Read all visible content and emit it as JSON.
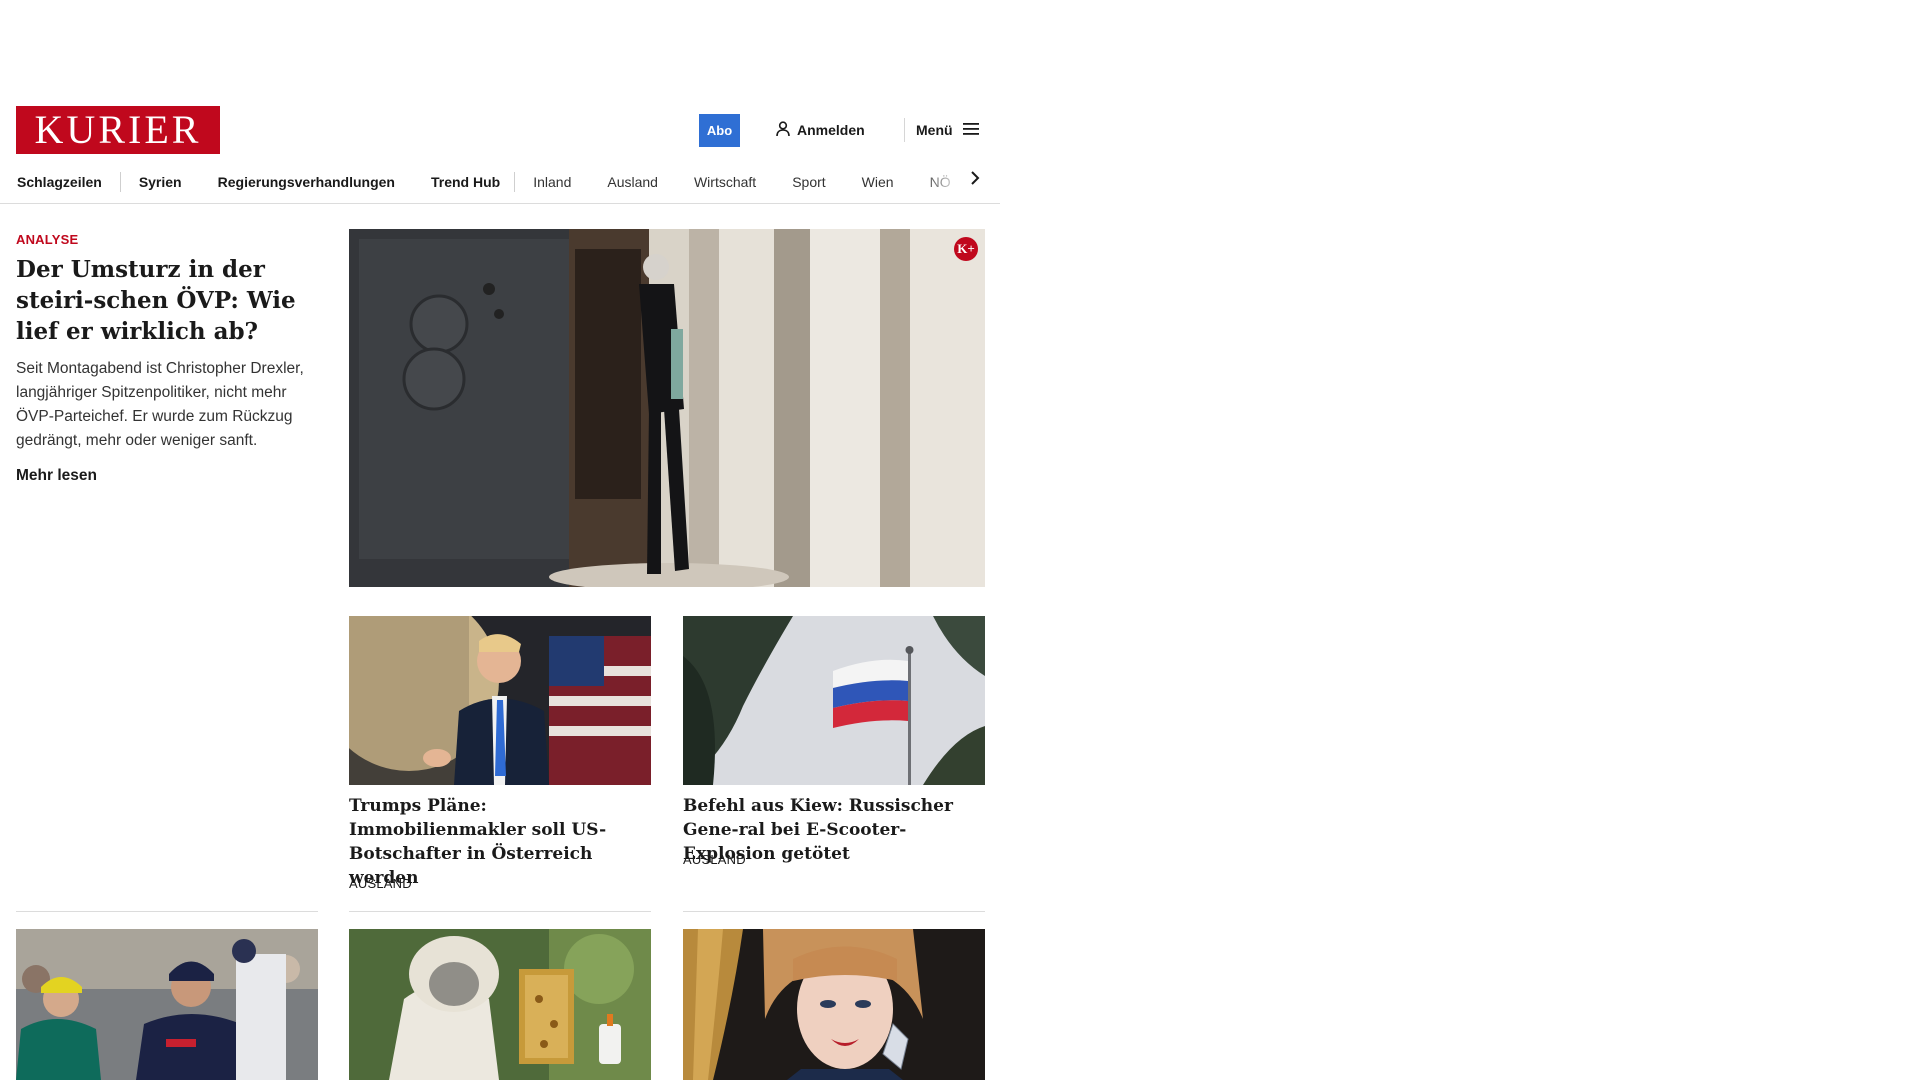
{
  "header": {
    "logo_text": "KURIER",
    "abo_label": "Abo",
    "login_label": "Anmelden",
    "menu_label": "Menü"
  },
  "nav": {
    "items": [
      {
        "label": "Schlagzeilen"
      },
      {
        "label": "Syrien"
      },
      {
        "label": "Regierungsverhandlungen"
      },
      {
        "label": "Trend Hub"
      },
      {
        "label": "Inland"
      },
      {
        "label": "Ausland"
      },
      {
        "label": "Wirtschaft"
      },
      {
        "label": "Sport"
      },
      {
        "label": "Wien"
      },
      {
        "label": "NÖ"
      }
    ]
  },
  "lead": {
    "kicker": "ANALYSE",
    "title": "Der Umsturz in der steiri-schen ÖVP: Wie lief er wirklich ab?",
    "body": "Seit Montagabend ist Christopher Drexler, langjähriger Spitzenpolitiker, nicht mehr ÖVP-Parteichef. Er wurde zum Rückzug gedrängt, mehr oder weniger sanft.",
    "read_more": "Mehr lesen",
    "badge": "K+"
  },
  "cards": [
    {
      "title": "Trumps Pläne: Immobilienmakler soll US-Botschafter in Österreich werden",
      "category": "AUSLAND"
    },
    {
      "title": "Befehl aus Kiew: Russischer Gene-ral bei E-Scooter-Explosion getötet",
      "category": "AUSLAND"
    }
  ],
  "colors": {
    "brand_red": "#c0081d",
    "abo_blue": "#2f6fd4"
  },
  "icons": {
    "login": "user-icon",
    "menu": "hamburger-icon",
    "nav_more": "chevron-right-icon",
    "premium": "kplus-badge-icon"
  }
}
